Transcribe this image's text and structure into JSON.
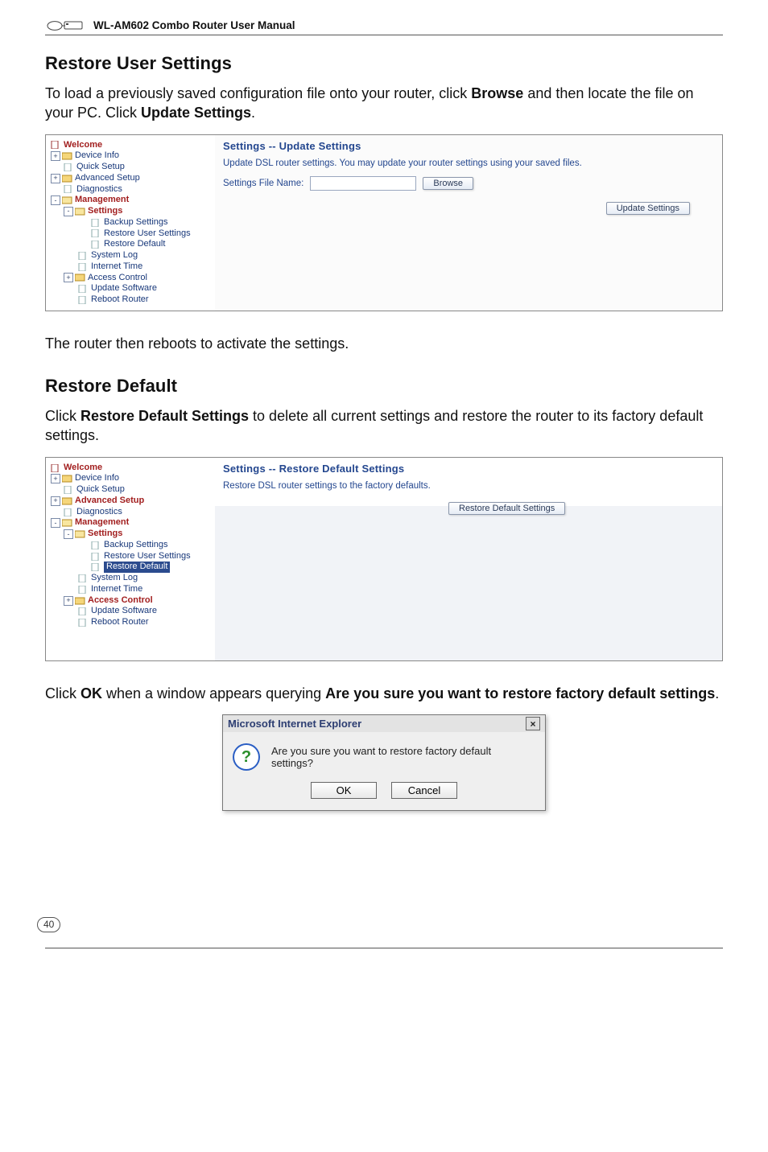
{
  "header": {
    "product_title": "WL-AM602 Combo Router User Manual"
  },
  "page_number": "40",
  "sections": {
    "restore_user": {
      "title": "Restore User Settings",
      "p1_a": "To load a previously saved configuration file onto your router, click ",
      "p1_bold1": "Browse",
      "p1_b": " and then locate the file on your PC. Click ",
      "p1_bold2": "Update Settings",
      "p1_c": ".",
      "after": "The router then reboots to activate the settings."
    },
    "restore_default": {
      "title": "Restore Default",
      "p1_a": "Click ",
      "p1_bold1": "Restore Default Settings",
      "p1_b": " to delete all current settings and restore the router to its factory default settings.",
      "p2_a": "Click ",
      "p2_bold1": "OK",
      "p2_b": " when a window appears querying ",
      "p2_bold2": "Are you sure you want to restore factory default settings",
      "p2_c": "."
    }
  },
  "screenshot1": {
    "content": {
      "title": "Settings -- Update Settings",
      "desc": "Update DSL router settings. You may update your router settings using your saved files.",
      "form_label": "Settings File Name:",
      "btn_browse": "Browse",
      "btn_update": "Update Settings"
    },
    "nav": {
      "welcome": "Welcome",
      "device_info": "Device Info",
      "quick_setup": "Quick Setup",
      "advanced_setup": "Advanced Setup",
      "diagnostics": "Diagnostics",
      "management": "Management",
      "settings": "Settings",
      "backup": "Backup Settings",
      "restore_user": "Restore User Settings",
      "restore_default": "Restore Default",
      "system_log": "System Log",
      "internet_time": "Internet Time",
      "access_control": "Access Control",
      "update_software": "Update Software",
      "reboot_router": "Reboot Router"
    }
  },
  "screenshot2": {
    "content": {
      "title": "Settings -- Restore Default Settings",
      "desc": "Restore DSL router settings to the factory defaults.",
      "btn_restore": "Restore Default Settings"
    },
    "nav": {
      "welcome": "Welcome",
      "device_info": "Device Info",
      "quick_setup": "Quick Setup",
      "advanced_setup": "Advanced Setup",
      "diagnostics": "Diagnostics",
      "management": "Management",
      "settings": "Settings",
      "backup": "Backup Settings",
      "restore_user": "Restore User Settings",
      "restore_default": "Restore Default",
      "system_log": "System Log",
      "internet_time": "Internet Time",
      "access_control": "Access Control",
      "update_software": "Update Software",
      "reboot_router": "Reboot Router"
    }
  },
  "dialog": {
    "title": "Microsoft Internet Explorer",
    "message": "Are you sure you want to restore factory default settings?",
    "ok": "OK",
    "cancel": "Cancel"
  }
}
